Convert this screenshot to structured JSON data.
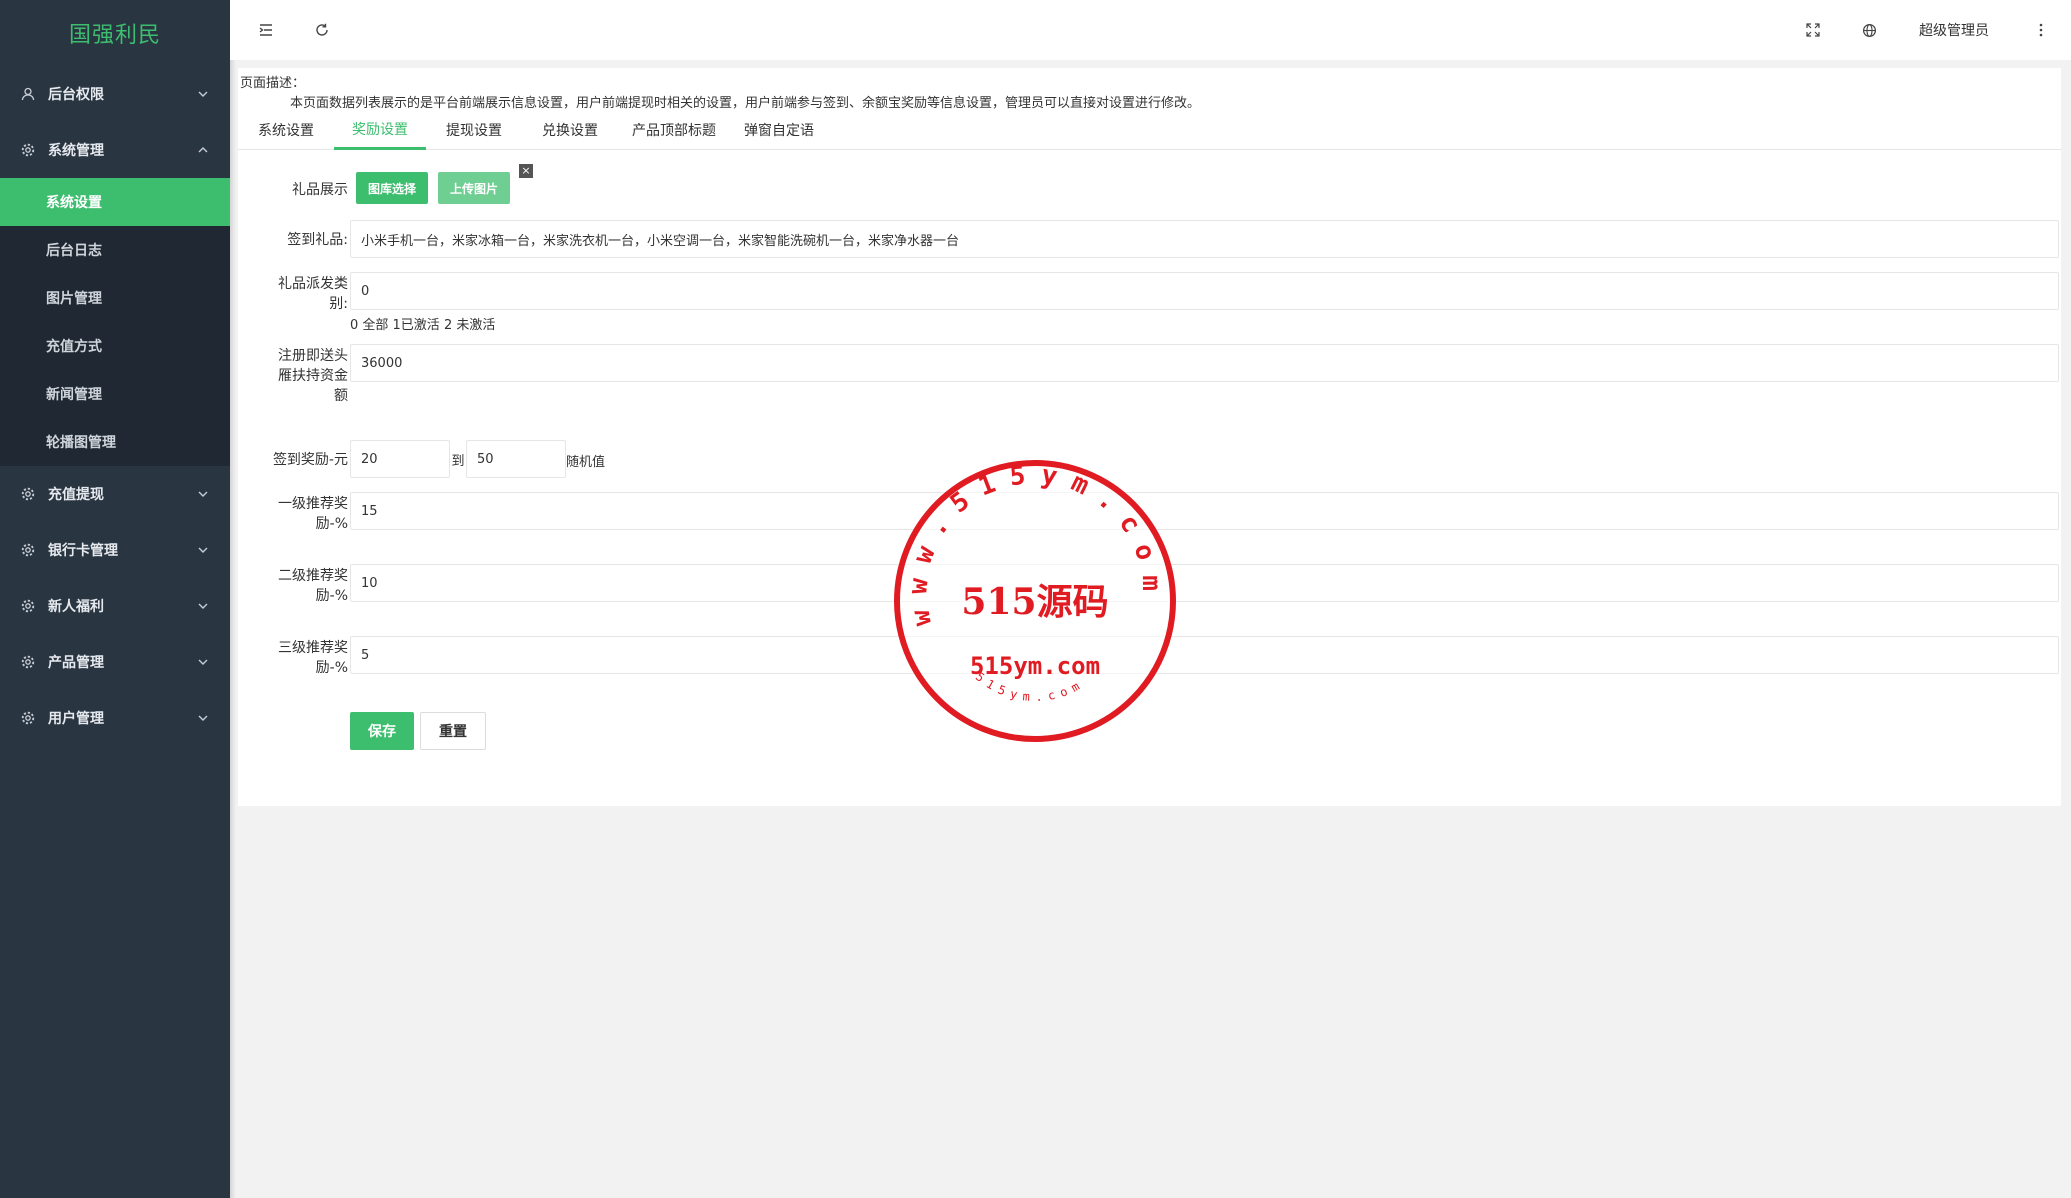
{
  "app": {
    "logo_text": "国强利民"
  },
  "header": {
    "admin_label": "超级管理员"
  },
  "sidebar": {
    "groups": [
      {
        "label": "后台权限",
        "icon": "user-icon",
        "expanded": false
      },
      {
        "label": "系统管理",
        "icon": "gear-icon",
        "expanded": true,
        "items": [
          "系统设置",
          "后台日志",
          "图片管理",
          "充值方式",
          "新闻管理",
          "轮播图管理"
        ],
        "active_index": 0
      },
      {
        "label": "充值提现",
        "icon": "gear-icon",
        "expanded": false
      },
      {
        "label": "银行卡管理",
        "icon": "gear-icon",
        "expanded": false
      },
      {
        "label": "新人福利",
        "icon": "gear-icon",
        "expanded": false
      },
      {
        "label": "产品管理",
        "icon": "gear-icon",
        "expanded": false
      },
      {
        "label": "用户管理",
        "icon": "gear-icon",
        "expanded": false
      }
    ]
  },
  "page": {
    "desc_title": "页面描述：",
    "desc_text": "本页面数据列表展示的是平台前端展示信息设置，用户前端提现时相关的设置，用户前端参与签到、余额宝奖励等信息设置，管理员可以直接对设置进行修改。",
    "tabs": [
      "系统设置",
      "奖励设置",
      "提现设置",
      "兑换设置",
      "产品顶部标题",
      "弹窗自定语"
    ],
    "active_tab": 1
  },
  "form": {
    "gift_display": {
      "label": "礼品展示",
      "gallery_button": "图库选择",
      "upload_button": "上传图片",
      "close_icon": "×"
    },
    "signin_gift": {
      "label": "签到礼品:",
      "value": "小米手机一台，米家冰箱一台，米家洗衣机一台，小米空调一台，米家智能洗碗机一台，米家净水器一台"
    },
    "gift_category": {
      "label_line1": "礼品派发类",
      "label_line2": "别:",
      "value": "0",
      "hint": "0 全部 1已激活 2 未激活"
    },
    "register_fund": {
      "label_line1": "注册即送头",
      "label_line2": "雁扶持资金",
      "label_line3": "额",
      "value": "36000"
    },
    "signin_reward": {
      "label": "签到奖励-元",
      "min": "20",
      "sep": "到",
      "max": "50",
      "suffix": "随机值"
    },
    "level1": {
      "label_line1": "一级推荐奖",
      "label_line2": "励-%",
      "value": "15"
    },
    "level2": {
      "label_line1": "二级推荐奖",
      "label_line2": "励-%",
      "value": "10"
    },
    "level3": {
      "label_line1": "三级推荐奖",
      "label_line2": "励-%",
      "value": "5"
    },
    "save_button": "保存",
    "reset_button": "重置"
  },
  "watermark": {
    "center_text": "515源码",
    "bottom_text": "515ym.com",
    "ring_text": "www.515ym.com",
    "small_text": "515ym.com"
  },
  "colors": {
    "accent": "#3dbd6e",
    "sidebar_bg": "#2a3542",
    "stamp_red": "#e01b22"
  }
}
